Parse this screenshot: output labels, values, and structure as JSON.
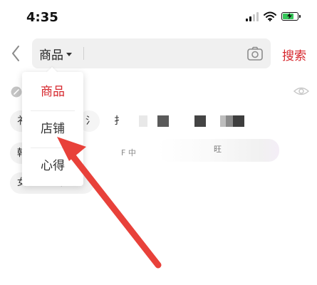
{
  "status_bar": {
    "time": "4:35"
  },
  "search": {
    "category": "商品",
    "query": "",
    "submit_label": "搜索"
  },
  "dropdown": {
    "items": [
      {
        "label": "商品",
        "selected": true
      },
      {
        "label": "店铺",
        "selected": false
      },
      {
        "label": "心得",
        "selected": false
      }
    ]
  },
  "history": {
    "chips": [
      "衤",
      "氵",
      "扌",
      "韩",
      "F 中",
      "旺",
      "女士日丹雪"
    ]
  },
  "colors": {
    "accent": "#d6262c",
    "arrow": "#e8413a",
    "battery": "#35c759"
  },
  "icons": {
    "back": "chevron-left-icon",
    "camera": "camera-icon",
    "history": "clock-icon",
    "visibility": "eye-icon",
    "wifi": "wifi-icon",
    "signal": "signal-icon",
    "battery": "battery-charging-icon"
  }
}
